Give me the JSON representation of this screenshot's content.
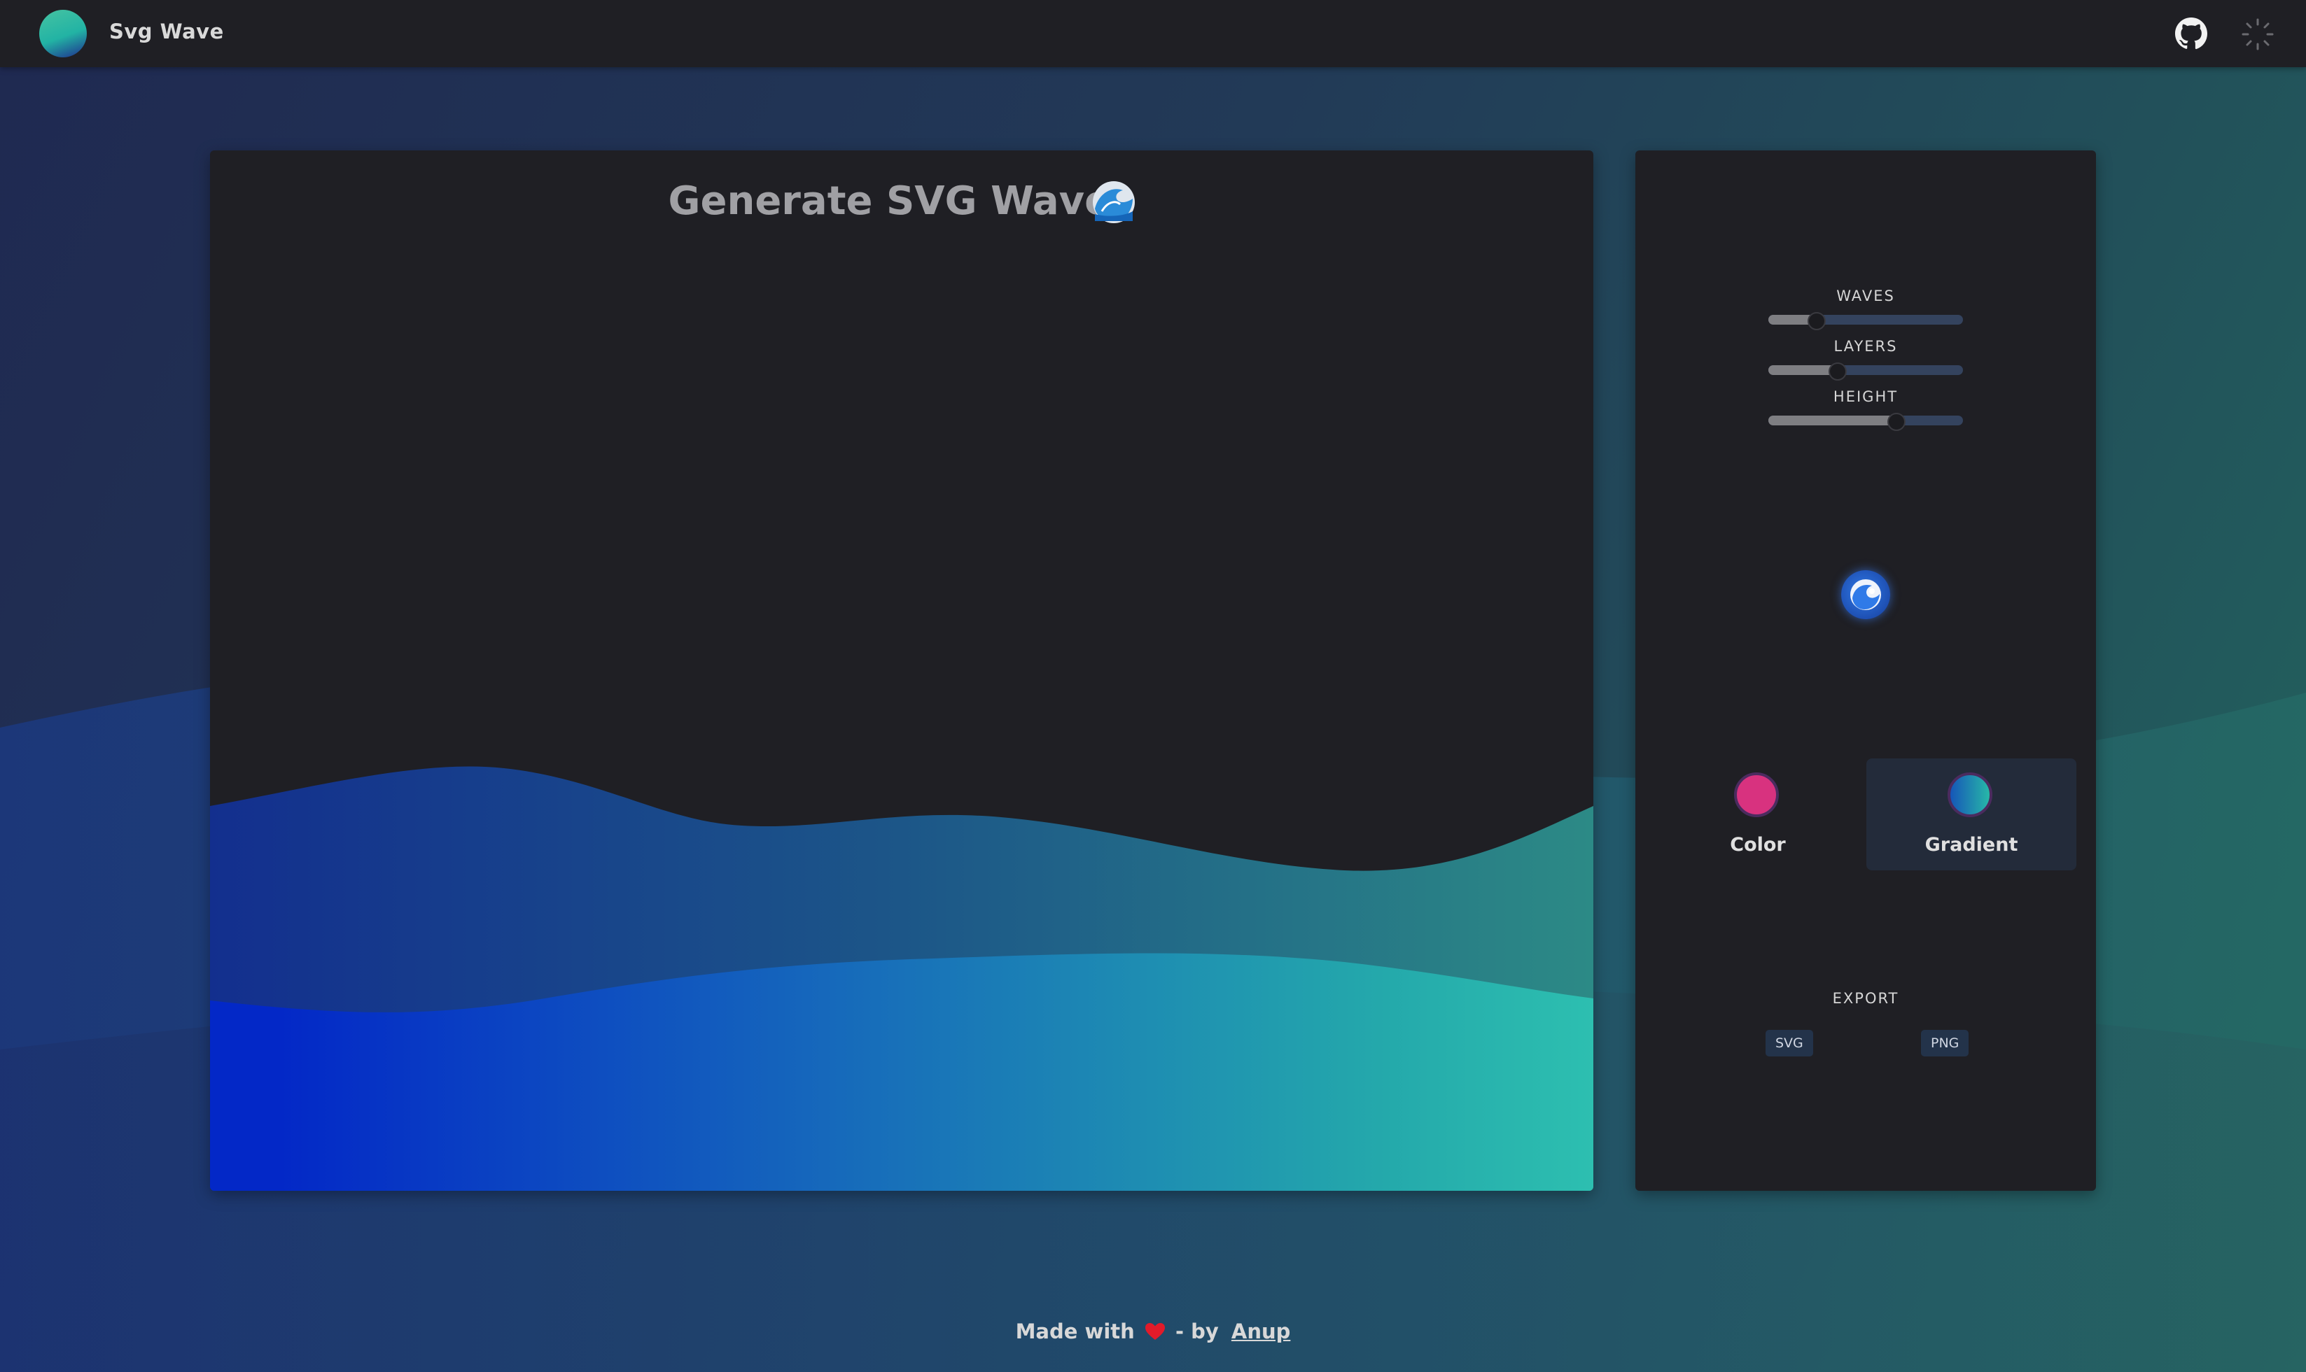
{
  "nav": {
    "brand": "Svg Wave",
    "github_icon": "github-icon",
    "theme_icon": "theme-toggle-icon"
  },
  "preview": {
    "title": "Generate SVG Waves",
    "title_emoji": "wave-emoji",
    "gradient_colors": [
      "#0328c7",
      "#1669bb",
      "#24b4a8",
      "#2dbfb0"
    ]
  },
  "controls": {
    "waves": {
      "label": "WAVES",
      "value_fraction": 0.24
    },
    "layers": {
      "label": "LAYERS",
      "value_fraction": 0.35
    },
    "height": {
      "label": "HEIGHT",
      "value_fraction": 0.65
    },
    "randomize_icon": "randomize-wave-icon",
    "modes": [
      {
        "label": "Color",
        "swatch": "#d8327f",
        "selected": false
      },
      {
        "label": "Gradient",
        "swatch": "gradient",
        "selected": true
      }
    ],
    "export": {
      "label": "EXPORT",
      "svg_label": "SVG",
      "png_label": "PNG"
    }
  },
  "footer": {
    "made_with": "Made with",
    "by": "- by",
    "author": "Anup",
    "heart_icon": "heart-icon"
  }
}
